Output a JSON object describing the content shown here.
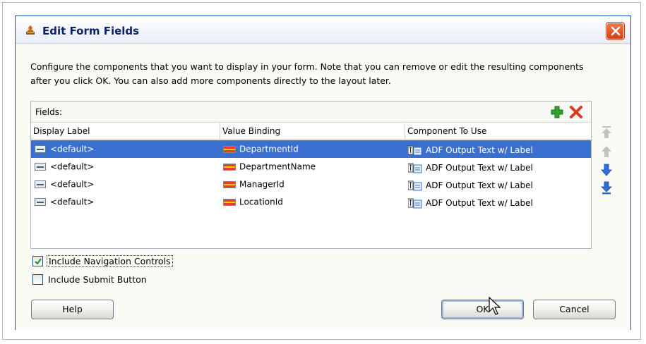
{
  "window": {
    "title": "Edit Form Fields",
    "description": "Configure the components that you want to display in your form.  Note that you can remove or edit the resulting components after you click OK.  You can also add more components directly to the layout later."
  },
  "fields": {
    "label": "Fields:",
    "add_icon": "plus-icon",
    "remove_icon": "x-icon",
    "columns": [
      "Display Label",
      "Value Binding",
      "Component To Use"
    ],
    "rows": [
      {
        "display_label": "<default>",
        "value_binding": "DepartmentId",
        "component": "ADF Output Text w/ Label",
        "selected": true
      },
      {
        "display_label": "<default>",
        "value_binding": "DepartmentName",
        "component": "ADF Output Text w/ Label",
        "selected": false
      },
      {
        "display_label": "<default>",
        "value_binding": "ManagerId",
        "component": "ADF Output Text w/ Label",
        "selected": false
      },
      {
        "display_label": "<default>",
        "value_binding": "LocationId",
        "component": "ADF Output Text w/ Label",
        "selected": false
      }
    ]
  },
  "reorder_buttons": [
    "move-top-icon",
    "move-up-icon",
    "move-down-icon",
    "move-bottom-icon"
  ],
  "options": {
    "nav_controls": {
      "label": "Include Navigation Controls",
      "checked": true
    },
    "submit_button": {
      "label": "Include Submit Button",
      "checked": false
    }
  },
  "buttons": {
    "help": "Help",
    "ok": "OK",
    "cancel": "Cancel"
  },
  "colors": {
    "selection": "#3a6fcf",
    "title_text": "#0a246a",
    "close_button": "#d0411c",
    "add_icon": "#2fa52f",
    "remove_icon": "#d93a1c",
    "arrow_icons": "#2f6fd8"
  }
}
